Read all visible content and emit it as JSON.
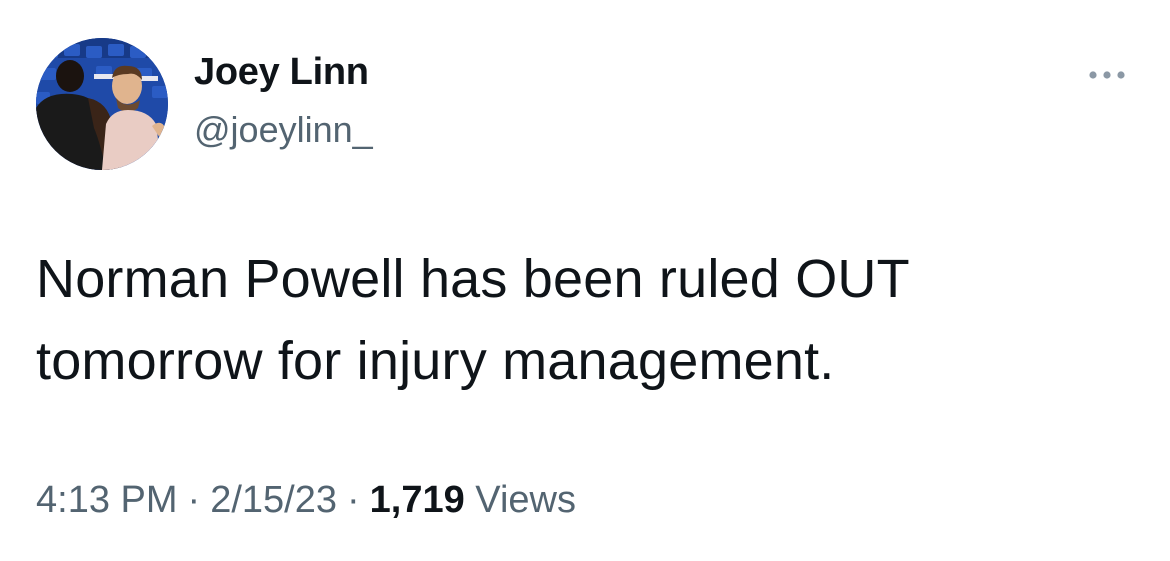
{
  "author": {
    "display_name": "Joey Linn",
    "handle": "@joeylinn_"
  },
  "tweet": {
    "text_line1": "Norman Powell has been ruled OUT",
    "text_line2": "tomorrow for injury management."
  },
  "meta": {
    "time": "4:13 PM",
    "separator": "·",
    "date": "2/15/23",
    "views_count": "1,719",
    "views_label": "Views"
  },
  "icons": {
    "more": "more-horizontal-icon",
    "avatar": "profile-photo"
  },
  "colors": {
    "text": "#0f1419",
    "secondary": "#536471",
    "background": "#ffffff"
  }
}
